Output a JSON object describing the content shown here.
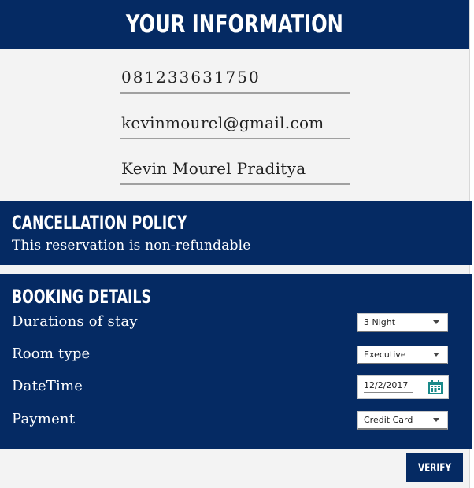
{
  "header": {
    "title": "YOUR INFORMATION"
  },
  "info": {
    "phone": "081233631750",
    "email": "kevinmourel@gmail.com",
    "name": "Kevin Mourel Praditya"
  },
  "cancellation": {
    "title": "CANCELLATION POLICY",
    "text": "This reservation is non-refundable"
  },
  "booking": {
    "title": "BOOKING DETAILS",
    "duration_label": "Durations of stay",
    "duration_value": "3 Night",
    "room_label": "Room type",
    "room_value": "Executive",
    "datetime_label": "DateTime",
    "datetime_value": "12/2/2017",
    "payment_label": "Payment",
    "payment_value": "Credit Card"
  },
  "actions": {
    "verify_label": "VERIFY"
  },
  "colors": {
    "primary": "#052a63",
    "background": "#f3f3f3",
    "calendar_icon": "#1a8a8a"
  },
  "icons": {
    "dropdown": "chevron-down-icon",
    "date": "calendar-icon"
  }
}
